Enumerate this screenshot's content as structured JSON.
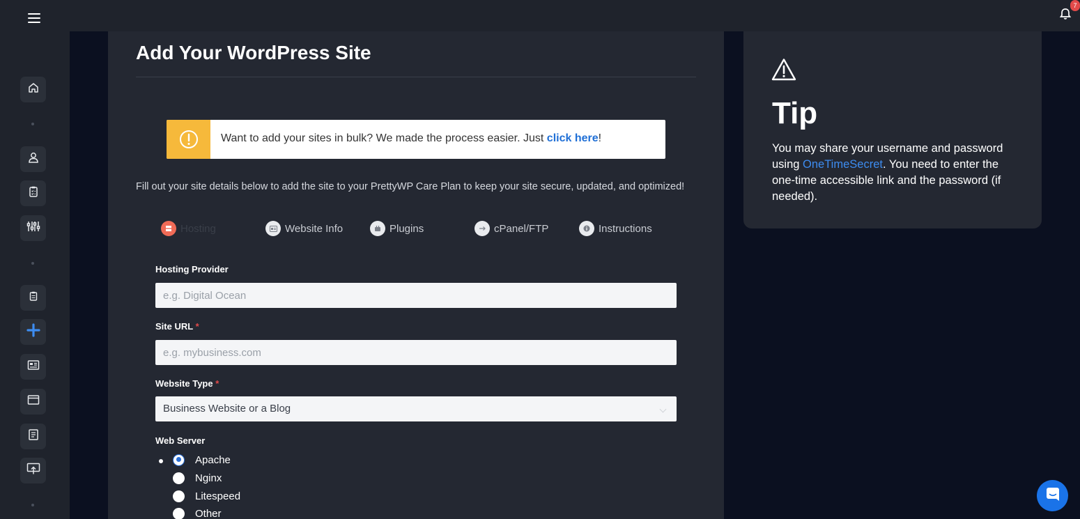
{
  "topbar": {
    "menu_icon": "hamburger-icon",
    "bell_icon": "bell-icon",
    "notification_count": "7"
  },
  "sidebar": {
    "items": [
      {
        "icon": "home-icon"
      },
      {
        "icon": "user-icon"
      },
      {
        "icon": "clipboard-icon"
      },
      {
        "icon": "sliders-icon"
      },
      {
        "icon": "clipboard-small-icon"
      },
      {
        "icon": "plus-icon"
      },
      {
        "icon": "newspaper-icon"
      },
      {
        "icon": "browser-window-icon"
      },
      {
        "icon": "document-icon"
      },
      {
        "icon": "upload-monitor-icon"
      }
    ]
  },
  "main": {
    "title": "Add Your WordPress Site",
    "notice": {
      "icon": "exclamation-circle-icon",
      "text_before": "Want to add your sites in bulk? We made the process easier. Just ",
      "link": "click here",
      "text_after": "!"
    },
    "lead": "Fill out your site details below to add the site to your PrettyWP Care Plan to keep your site secure, updated, and optimized!",
    "steps": [
      {
        "label": "Hosting",
        "icon": "server-icon",
        "active": true
      },
      {
        "label": "Website Info",
        "icon": "id-card-icon",
        "active": false
      },
      {
        "label": "Plugins",
        "icon": "plugin-icon",
        "active": false
      },
      {
        "label": "cPanel/FTP",
        "icon": "arrow-right-icon",
        "active": false
      },
      {
        "label": "Instructions",
        "icon": "info-icon",
        "active": false
      }
    ],
    "form": {
      "hosting_provider": {
        "label": "Hosting Provider",
        "placeholder": "e.g. Digital Ocean",
        "value": ""
      },
      "site_url": {
        "label": "Site URL",
        "required_mark": "*",
        "placeholder": "e.g. mybusiness.com",
        "value": ""
      },
      "website_type": {
        "label": "Website Type",
        "required_mark": "*",
        "value": "Business Website or a Blog"
      },
      "web_server": {
        "label": "Web Server",
        "options": [
          "Apache",
          "Nginx",
          "Litespeed",
          "Other"
        ],
        "selected": "Apache"
      }
    }
  },
  "tip": {
    "icon": "warning-triangle-icon",
    "title": "Tip",
    "text_before": "You may share your username and password using ",
    "link": "OneTimeSecret",
    "text_after": ". You need to enter the one-time accessible link and the password (if needed)."
  },
  "chat": {
    "icon": "chat-icon"
  },
  "colors": {
    "accent": "#1a73e8",
    "warning": "#f6b93b",
    "active_step": "#f06b57",
    "panel": "#242832",
    "background": "#0b1020"
  }
}
